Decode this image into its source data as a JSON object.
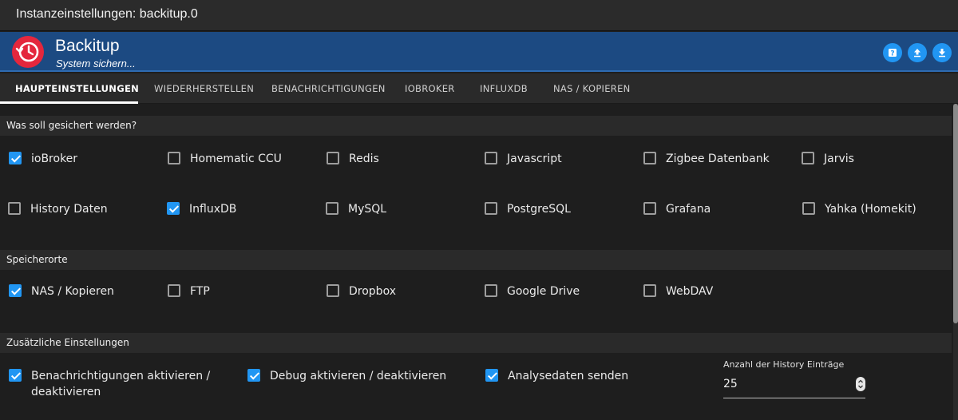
{
  "window": {
    "title": "Instanzeinstellungen: backitup.0"
  },
  "header": {
    "app_name": "Backitup",
    "subtitle": "System sichern...",
    "logo_icon": "restore-clock-icon",
    "buttons": [
      {
        "name": "help-button",
        "icon": "question-icon"
      },
      {
        "name": "upload-button",
        "icon": "upload-icon"
      },
      {
        "name": "download-button",
        "icon": "download-icon"
      }
    ],
    "accent": "#2196f3",
    "bar_color": "#1c4a82",
    "logo_color": "#e4273d"
  },
  "tabs": [
    {
      "label": "HAUPTEINSTELLUNGEN",
      "active": true
    },
    {
      "label": "WIEDERHERSTELLEN",
      "active": false
    },
    {
      "label": "BENACHRICHTIGUNGEN",
      "active": false
    },
    {
      "label": "IOBROKER",
      "active": false
    },
    {
      "label": "INFLUXDB",
      "active": false
    },
    {
      "label": "NAS / KOPIEREN",
      "active": false
    }
  ],
  "sections": {
    "backup": {
      "title": "Was soll gesichert werden?",
      "items": [
        {
          "label": "ioBroker",
          "checked": true
        },
        {
          "label": "Homematic CCU",
          "checked": false
        },
        {
          "label": "Redis",
          "checked": false
        },
        {
          "label": "Javascript",
          "checked": false
        },
        {
          "label": "Zigbee Datenbank",
          "checked": false
        },
        {
          "label": "Jarvis",
          "checked": false
        },
        {
          "label": "History Daten",
          "checked": false
        },
        {
          "label": "InfluxDB",
          "checked": true
        },
        {
          "label": "MySQL",
          "checked": false
        },
        {
          "label": "PostgreSQL",
          "checked": false
        },
        {
          "label": "Grafana",
          "checked": false
        },
        {
          "label": "Yahka (Homekit)",
          "checked": false
        }
      ]
    },
    "storage": {
      "title": "Speicherorte",
      "items": [
        {
          "label": "NAS / Kopieren",
          "checked": true
        },
        {
          "label": "FTP",
          "checked": false
        },
        {
          "label": "Dropbox",
          "checked": false
        },
        {
          "label": "Google Drive",
          "checked": false
        },
        {
          "label": "WebDAV",
          "checked": false
        }
      ]
    },
    "extra": {
      "title": "Zusätzliche Einstellungen",
      "items": [
        {
          "label": "Benachrichtigungen aktivieren / deaktivieren",
          "checked": true
        },
        {
          "label": "Debug aktivieren / deaktivieren",
          "checked": true
        },
        {
          "label": "Analysedaten senden",
          "checked": true
        }
      ],
      "history_field": {
        "label": "Anzahl der History Einträge",
        "value": "25"
      }
    }
  }
}
